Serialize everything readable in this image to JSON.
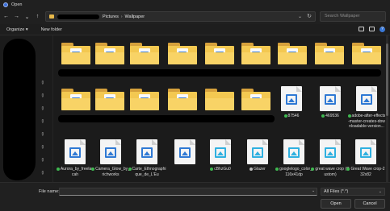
{
  "window": {
    "title": "Open"
  },
  "nav": {
    "back_icon": "arrow-left-icon",
    "forward_icon": "arrow-right-icon",
    "recent_icon": "chevron-down-icon",
    "up_icon": "arrow-up-icon"
  },
  "address": {
    "crumbs": [
      "Pictures",
      "Wallpaper"
    ],
    "separator": "›",
    "dropdown_glyph": "⌄",
    "refresh_glyph": "↻"
  },
  "search": {
    "placeholder": "Search Wallpaper"
  },
  "toolbar": {
    "organize": "Organize ▾",
    "new_folder": "New folder"
  },
  "files": [
    {
      "name": "87546",
      "status": "synced"
    },
    {
      "name": "469536",
      "status": "synced"
    },
    {
      "name": "adobe-after-effects-master-creates-downloadable-version...",
      "status": "synced"
    },
    {
      "name": "Aurora_by_freelancah",
      "status": "synced"
    },
    {
      "name": "Camera_Glow_by_richworks",
      "status": "synced"
    },
    {
      "name": "Carte_Ethnographique_de_L'Eu",
      "status": "synced"
    },
    {
      "name": "cBhzGu0",
      "status": "synced"
    },
    {
      "name": "Glazer",
      "status": "synced"
    },
    {
      "name": "googlelogo_color_116x41dp",
      "status": "available"
    },
    {
      "name": "great wave crop (Custom)",
      "status": "available"
    },
    {
      "name": "Great Wave crop-232x82",
      "status": "available"
    }
  ],
  "footer": {
    "filename_label": "File name:",
    "filename_value": "",
    "filter": "All Files (*.*)",
    "open": "Open",
    "cancel": "Cancel"
  },
  "colors": {
    "folder": "#f3c851",
    "accent": "#2f79d4",
    "sync_green": "#3fb950"
  }
}
